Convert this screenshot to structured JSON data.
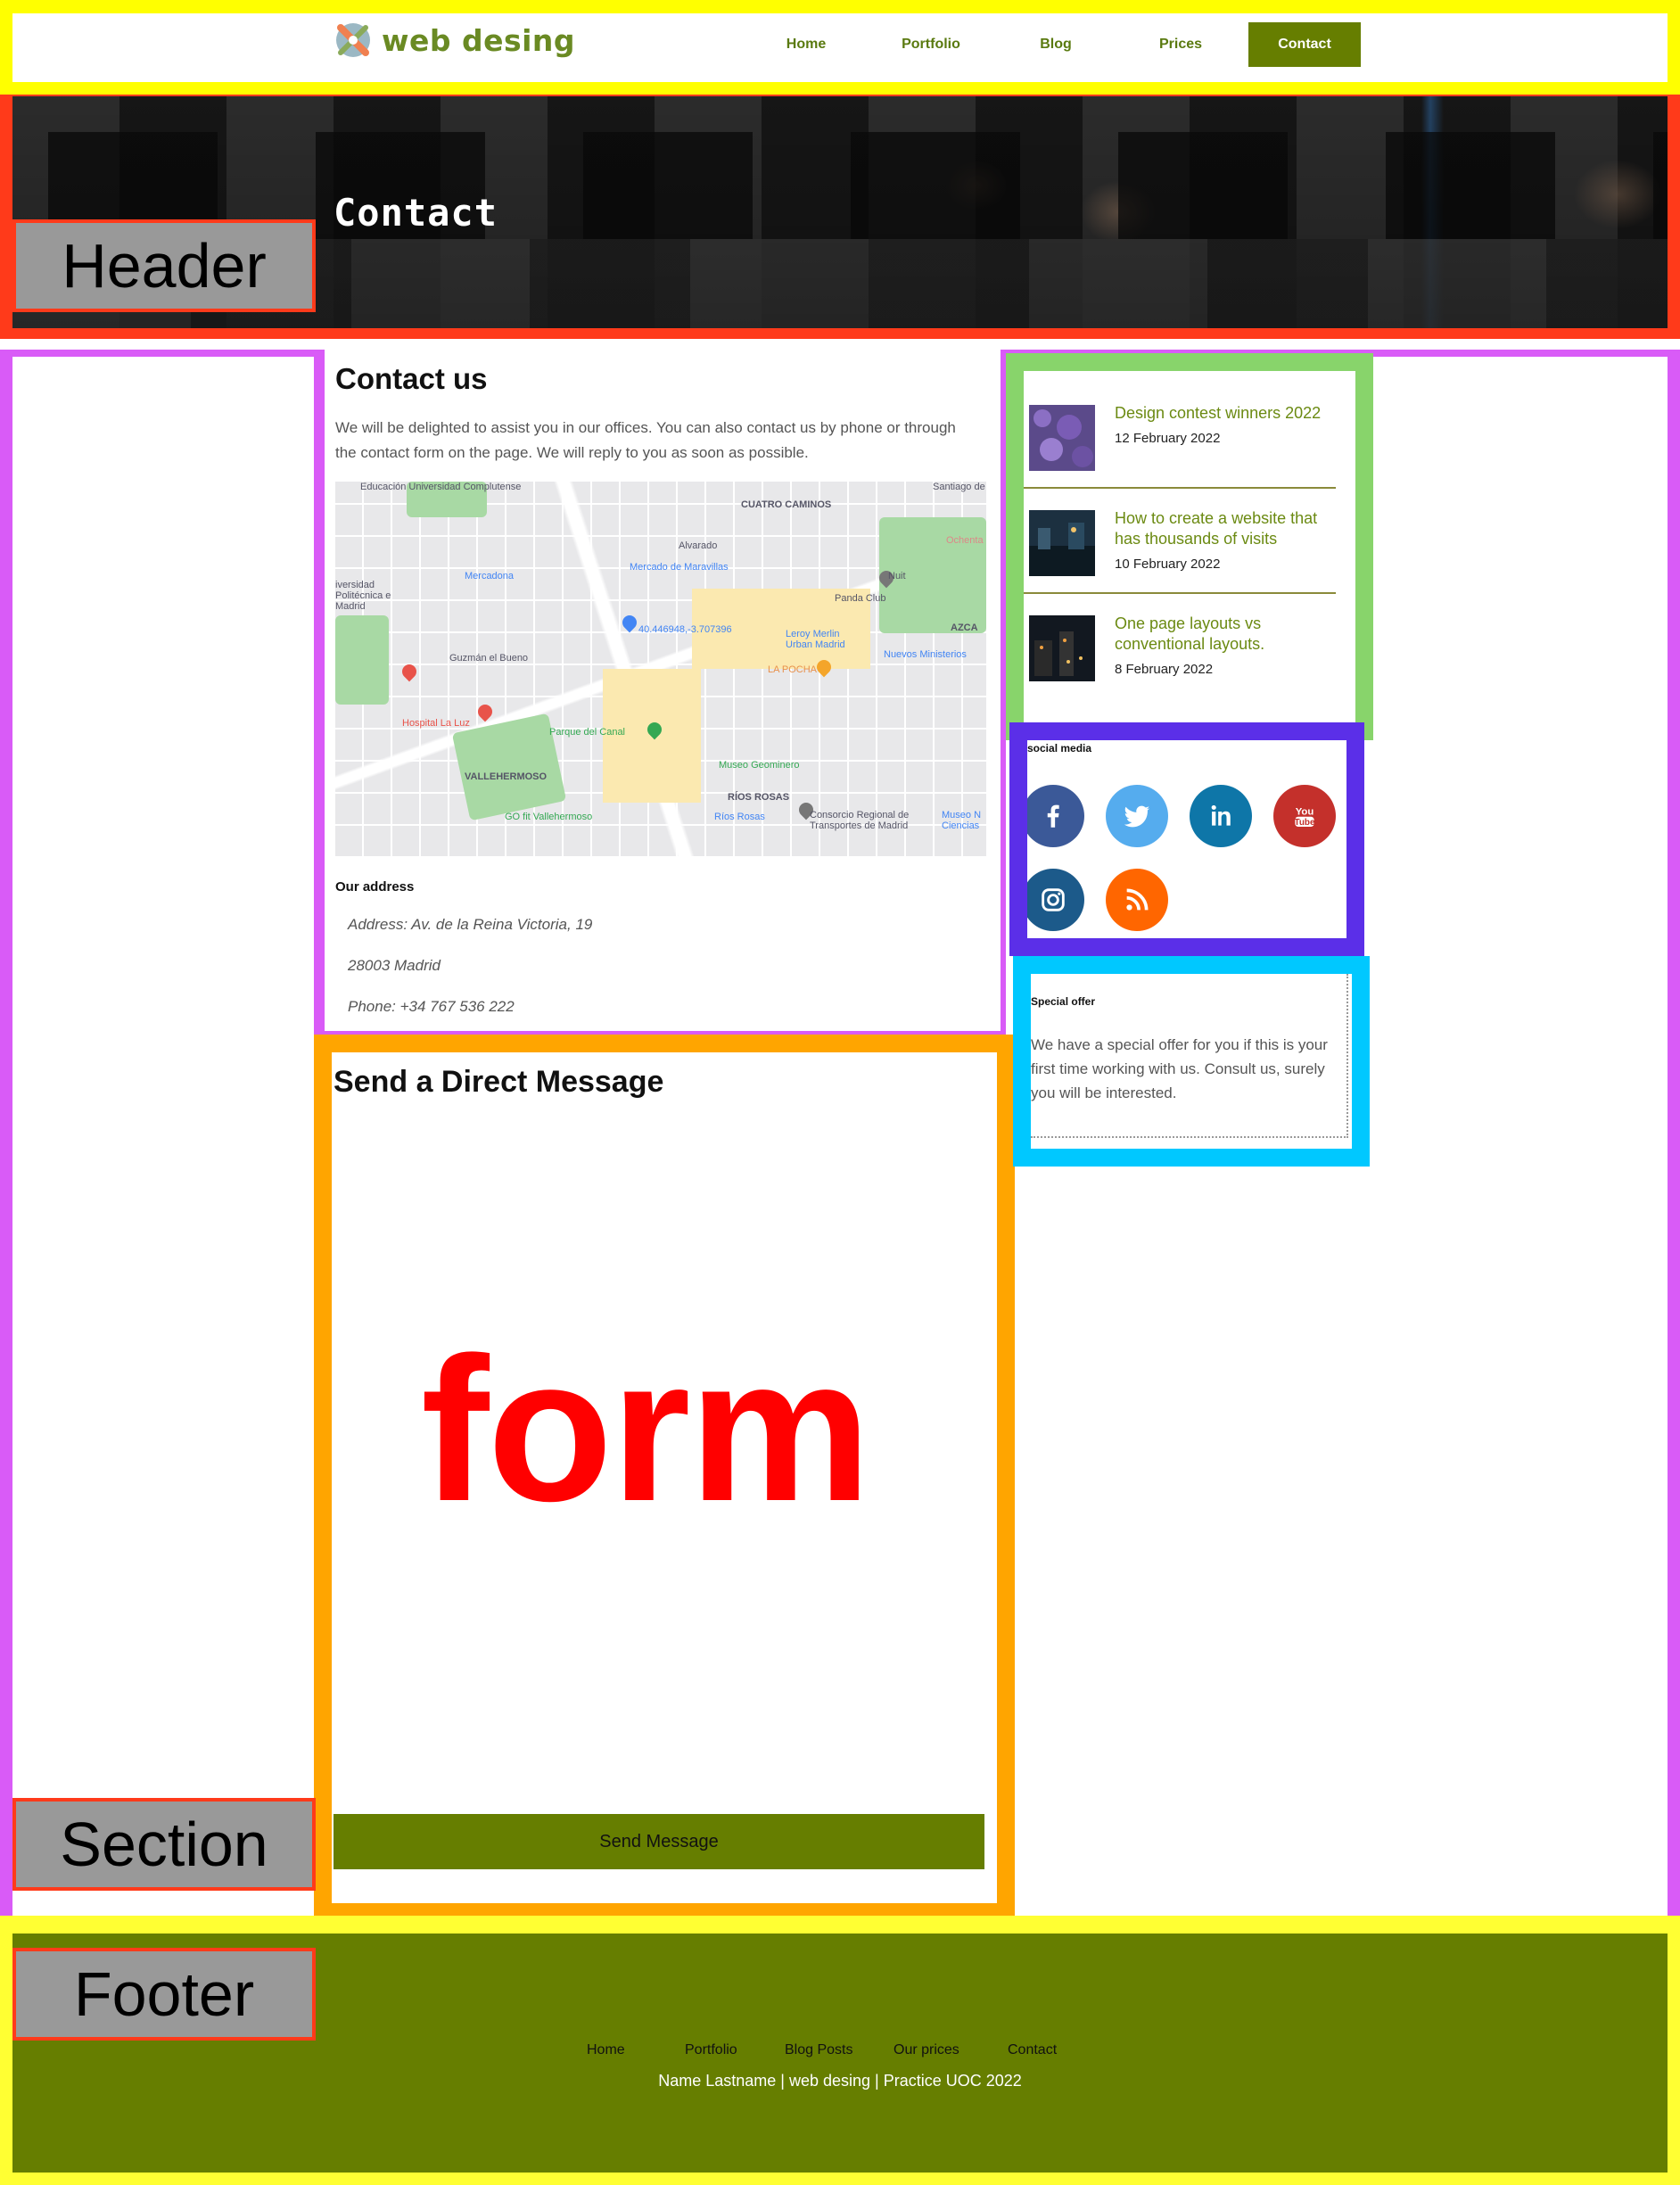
{
  "brand": {
    "name": "web desing",
    "accent": "#667e00"
  },
  "nav": {
    "items": [
      "Home",
      "Portfolio",
      "Blog",
      "Prices"
    ],
    "active": "Contact"
  },
  "header": {
    "title": "Contact"
  },
  "labels": {
    "header": "Header",
    "section": "Section",
    "footer": "Footer"
  },
  "contact": {
    "title": "Contact us",
    "text": "We will be delighted to assist you in our offices. You can also contact us by phone or through the contact form on the page. We will reply to you as soon as possible.",
    "map_labels": {
      "univ": "Educación Universidad Complutense",
      "cuatro": "CUATRO CAMINOS",
      "santiago": "Santiago de",
      "ochenta": "Ochenta",
      "alvarado": "Alvarado",
      "mercadona": "Mercadona",
      "maravillas": "Mercado de Maravillas",
      "panda": "Panda Club",
      "nuit": "Nuit",
      "upm": "iversidad Politécnica e Madrid",
      "coords": "40.446948,-3.707396",
      "leroy": "Leroy Merlin Urban Madrid",
      "azca": "AZCA",
      "guzman": "Guzmán el Bueno",
      "pocha": "LA POCHA",
      "nuevos": "Nuevos Ministerios",
      "hospital": "Hospital La Luz",
      "canal": "Parque del Canal",
      "vallehermoso": "VALLEHERMOSO",
      "geominero": "Museo Geominero",
      "rios": "RÍOS ROSAS",
      "go": "GO fit Vallehermoso",
      "consorcio": "Consorcio Regional de Transportes de Madrid",
      "museon": "Museo N Ciencias",
      "riosrosas": "Ríos Rosas"
    },
    "address_head": "Our address",
    "address": "Address: Av. de la Reina Victoria, 19",
    "city": "28003 Madrid",
    "phone": "Phone: +34 767 536 222"
  },
  "form": {
    "title": "Send a Direct Message",
    "placeholder_word": "form",
    "submit": "Send Message"
  },
  "posts": [
    {
      "title": "Design contest winners 2022",
      "date": "12 February 2022"
    },
    {
      "title": "How to create a website that has thousands of visits",
      "date": "10 February 2022"
    },
    {
      "title": "One page layouts vs conventional layouts.",
      "date": "8 February 2022"
    }
  ],
  "social": {
    "heading": "r social media",
    "icons": [
      {
        "name": "facebook-icon",
        "color": "#3b5998"
      },
      {
        "name": "twitter-icon",
        "color": "#55acee"
      },
      {
        "name": "linkedin-icon",
        "color": "#0e76a8"
      },
      {
        "name": "youtube-icon",
        "color": "#c4302b"
      },
      {
        "name": "instagram-icon",
        "color": "#1c5a8a"
      },
      {
        "name": "rss-icon",
        "color": "#ff6600"
      }
    ]
  },
  "offer": {
    "heading": "Special offer",
    "text": "We have a special offer for you if this is your first time working with us. Consult us, surely you will be interested."
  },
  "footer": {
    "links": [
      "Home",
      "Portfolio",
      "Blog Posts",
      "Our prices",
      "Contact"
    ],
    "credit": "Name Lastname | web desing | Practice UOC 2022"
  },
  "frame_colors": {
    "nav": "#ffff00",
    "header": "#ff3a1a",
    "section": "#d95bf7",
    "form": "#ffa500",
    "posts": "#88d46b",
    "social": "#5b2fe8",
    "offer": "#00c8ff",
    "footer": "#ffff33"
  }
}
